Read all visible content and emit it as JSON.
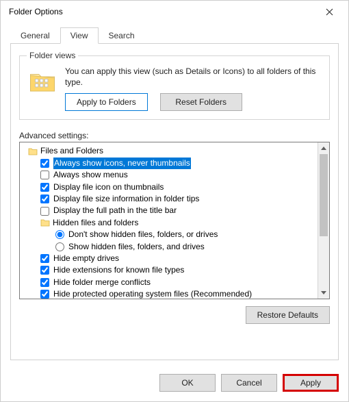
{
  "window": {
    "title": "Folder Options"
  },
  "tabs": {
    "general": "General",
    "view": "View",
    "search": "Search"
  },
  "folderViews": {
    "legend": "Folder views",
    "description": "You can apply this view (such as Details or Icons) to all folders of this type.",
    "applyBtn": "Apply to Folders",
    "resetBtn": "Reset Folders"
  },
  "advanced": {
    "label": "Advanced settings:",
    "rootLabel": "Files and Folders",
    "items": [
      {
        "kind": "checkbox",
        "checked": true,
        "selected": true,
        "label": "Always show icons, never thumbnails"
      },
      {
        "kind": "checkbox",
        "checked": false,
        "label": "Always show menus"
      },
      {
        "kind": "checkbox",
        "checked": true,
        "label": "Display file icon on thumbnails"
      },
      {
        "kind": "checkbox",
        "checked": true,
        "label": "Display file size information in folder tips"
      },
      {
        "kind": "checkbox",
        "checked": false,
        "label": "Display the full path in the title bar"
      },
      {
        "kind": "folder",
        "label": "Hidden files and folders",
        "children": [
          {
            "kind": "radio",
            "checked": true,
            "label": "Don't show hidden files, folders, or drives"
          },
          {
            "kind": "radio",
            "checked": false,
            "label": "Show hidden files, folders, and drives"
          }
        ]
      },
      {
        "kind": "checkbox",
        "checked": true,
        "label": "Hide empty drives"
      },
      {
        "kind": "checkbox",
        "checked": true,
        "label": "Hide extensions for known file types"
      },
      {
        "kind": "checkbox",
        "checked": true,
        "label": "Hide folder merge conflicts"
      },
      {
        "kind": "checkbox",
        "checked": true,
        "label": "Hide protected operating system files (Recommended)"
      }
    ],
    "restoreBtn": "Restore Defaults"
  },
  "buttons": {
    "ok": "OK",
    "cancel": "Cancel",
    "apply": "Apply"
  }
}
